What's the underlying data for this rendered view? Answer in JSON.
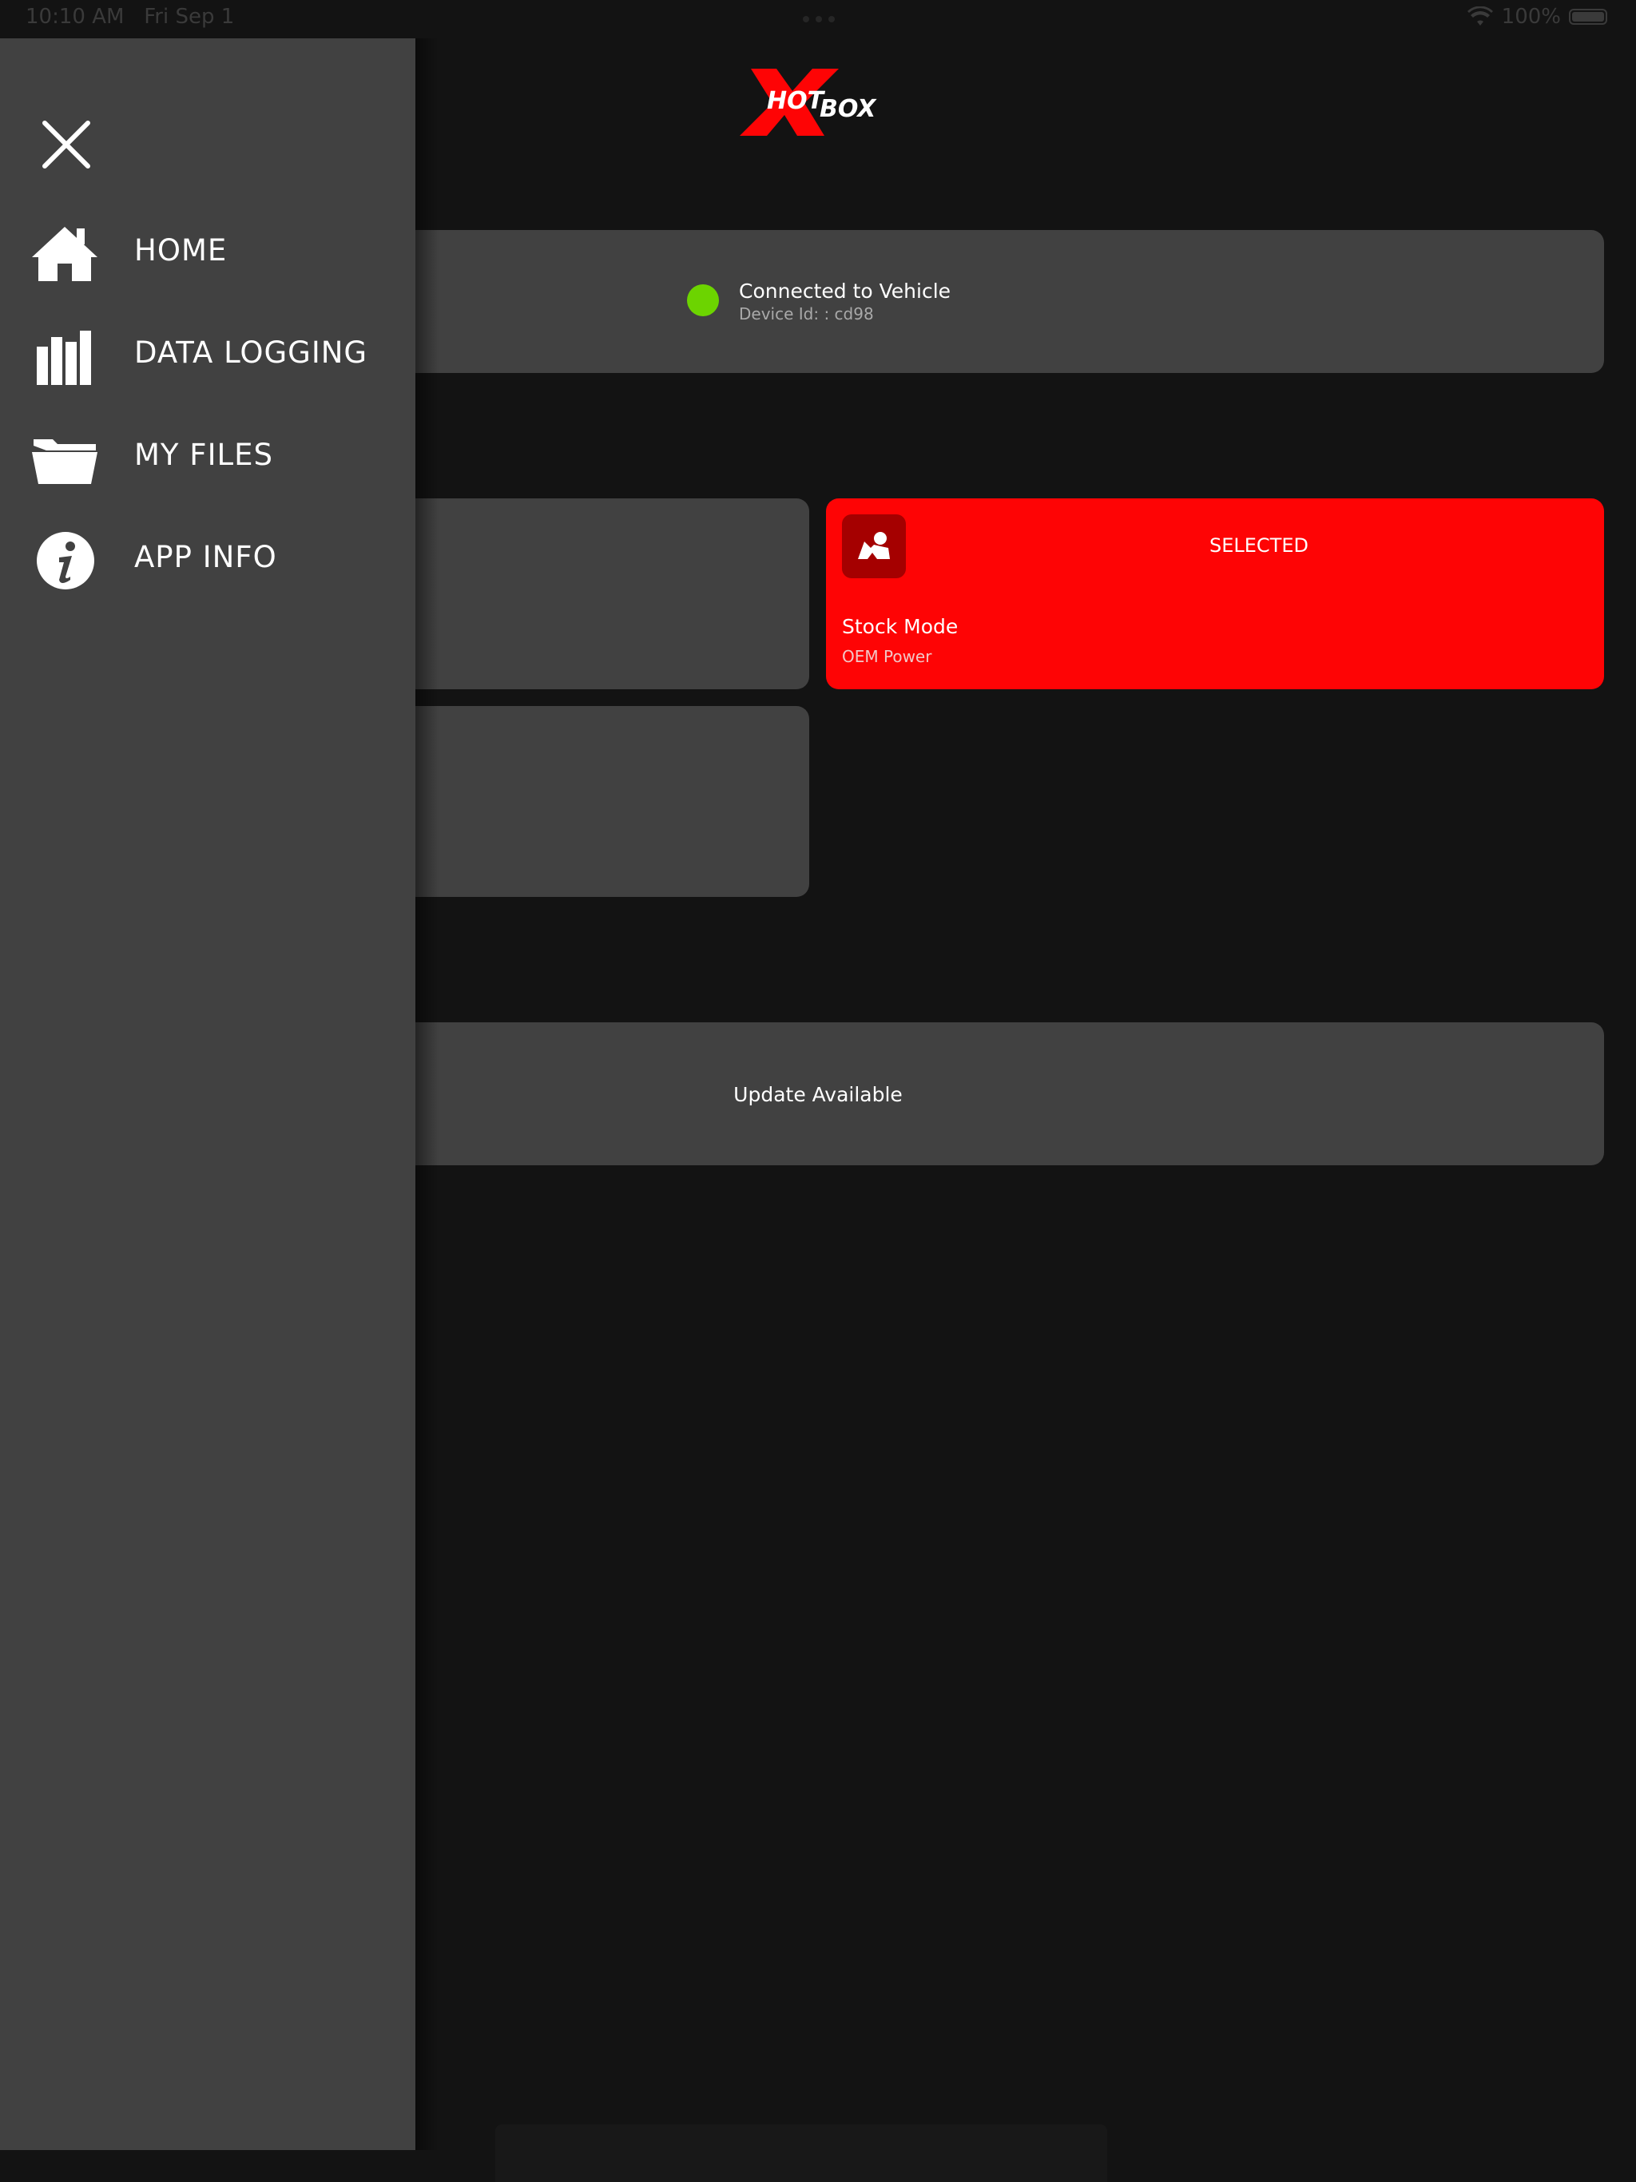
{
  "status_bar": {
    "time": "10:10 AM",
    "date": "Fri Sep 1",
    "battery": "100%",
    "icons": [
      "wifi-icon",
      "battery-icon"
    ]
  },
  "logo": {
    "text_hot": "HOT",
    "text_box": "BOX"
  },
  "connection": {
    "title": "Connected to Vehicle",
    "device": "Device Id: : cd98",
    "status_color": "#6cd400"
  },
  "modes": {
    "selected": {
      "badge": "SELECTED",
      "title": "Stock Mode",
      "subtitle": "OEM Power",
      "icon": "car-seat-icon",
      "color": "#fe0405"
    }
  },
  "update": {
    "label": "Update Available"
  },
  "drawer": {
    "close_icon": "close-icon",
    "items": [
      {
        "label": "HOME",
        "icon": "home-icon"
      },
      {
        "label": "DATA LOGGING",
        "icon": "data-logging-icon"
      },
      {
        "label": "MY FILES",
        "icon": "folder-icon"
      },
      {
        "label": "APP INFO",
        "icon": "info-icon"
      }
    ]
  },
  "colors": {
    "background": "#131313",
    "card": "#414141",
    "drawer": "#414141",
    "accent": "#fe0405"
  }
}
